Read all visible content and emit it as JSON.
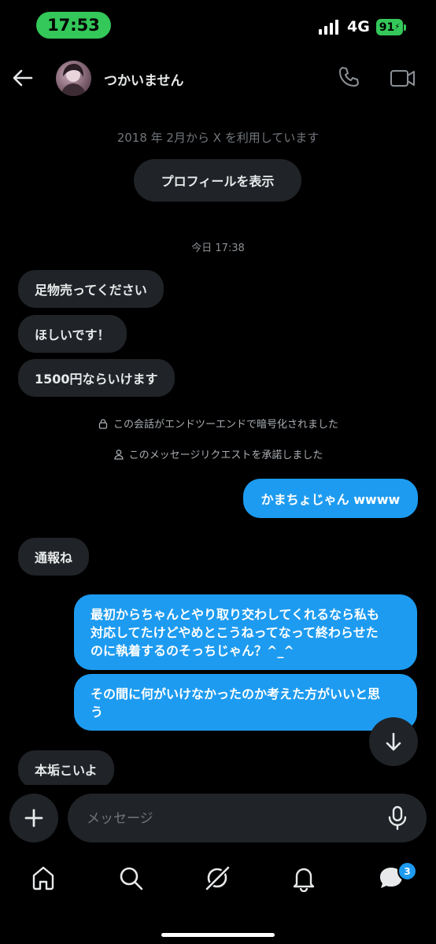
{
  "status_bar": {
    "time": "17:53",
    "network": "4G",
    "battery": "91"
  },
  "header": {
    "name": "つかいません"
  },
  "since_text": "2018 年 2月から X を利用しています",
  "profile_button": "プロフィールを表示",
  "date_label": "今日 17:38",
  "incoming_1": [
    "足物売ってください",
    "ほしいです！",
    "1500円ならいけます"
  ],
  "system_messages": {
    "encrypted": "この会話がエンドツーエンドで暗号化されました",
    "accepted": "このメッセージリクエストを承諾しました"
  },
  "outgoing_1": "かまちょじゃん wwww",
  "incoming_2": "通報ね",
  "outgoing_2": {
    "line1": "最初からちゃんとやり取り交わしてくれるなら私も",
    "line2": "対応してたけどやめとこうねってなって終わらせた",
    "line3": "のに執着するのそっちじゃん？^_^"
  },
  "outgoing_3": {
    "line1": "その間に何がいけなかったのか考えた方がいいと思",
    "line2": "う"
  },
  "incoming_3": "本垢こいよ",
  "compose": {
    "placeholder": "メッセージ"
  },
  "nav": {
    "messages_badge": "3"
  },
  "colors": {
    "accent": "#1d9bf0",
    "bubble_in": "#202327",
    "status_green": "#34c759"
  }
}
